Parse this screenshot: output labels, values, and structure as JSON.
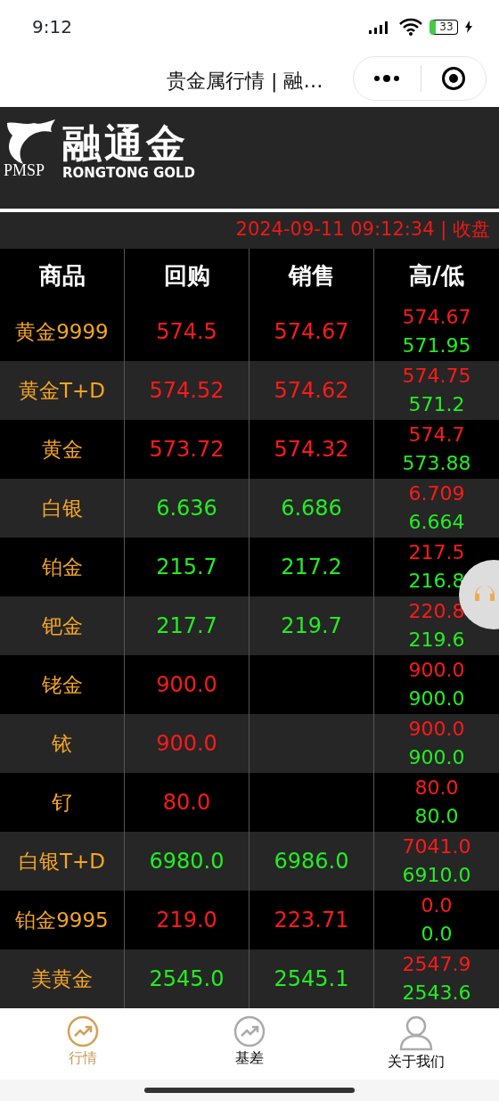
{
  "status_bar": {
    "time": "9:12",
    "battery": "33"
  },
  "title_bar": {
    "title": "贵金属行情 | 融…"
  },
  "header": {
    "logo_cn": "融通金",
    "logo_en": "RONGTONG GOLD",
    "logo_mark": "PMSP"
  },
  "timestamp": "2024-09-11 09:12:34 | 收盘",
  "table": {
    "columns": [
      "商品",
      "回购",
      "销售",
      "高/低"
    ],
    "rows": [
      {
        "name": "黄金9999",
        "buy": {
          "text": "574.5",
          "color": "#ff1a1a"
        },
        "sell": {
          "text": "574.67",
          "color": "#ff1a1a"
        },
        "high": {
          "text": "574.67",
          "color": "#ff1a1a"
        },
        "low": {
          "text": "571.95",
          "color": "#22ee22"
        }
      },
      {
        "name": "黄金T+D",
        "buy": {
          "text": "574.52",
          "color": "#ff1a1a"
        },
        "sell": {
          "text": "574.62",
          "color": "#ff1a1a"
        },
        "high": {
          "text": "574.75",
          "color": "#ff1a1a"
        },
        "low": {
          "text": "571.2",
          "color": "#22ee22"
        }
      },
      {
        "name": "黄金",
        "buy": {
          "text": "573.72",
          "color": "#ff1a1a"
        },
        "sell": {
          "text": "574.32",
          "color": "#ff1a1a"
        },
        "high": {
          "text": "574.7",
          "color": "#ff1a1a"
        },
        "low": {
          "text": "573.88",
          "color": "#22ee22"
        }
      },
      {
        "name": "白银",
        "buy": {
          "text": "6.636",
          "color": "#22ee22"
        },
        "sell": {
          "text": "6.686",
          "color": "#22ee22"
        },
        "high": {
          "text": "6.709",
          "color": "#ff1a1a"
        },
        "low": {
          "text": "6.664",
          "color": "#22ee22"
        }
      },
      {
        "name": "铂金",
        "buy": {
          "text": "215.7",
          "color": "#22ee22"
        },
        "sell": {
          "text": "217.2",
          "color": "#22ee22"
        },
        "high": {
          "text": "217.5",
          "color": "#ff1a1a"
        },
        "low": {
          "text": "216.8",
          "color": "#22ee22"
        }
      },
      {
        "name": "钯金",
        "buy": {
          "text": "217.7",
          "color": "#22ee22"
        },
        "sell": {
          "text": "219.7",
          "color": "#22ee22"
        },
        "high": {
          "text": "220.8",
          "color": "#ff1a1a"
        },
        "low": {
          "text": "219.6",
          "color": "#22ee22"
        }
      },
      {
        "name": "铑金",
        "buy": {
          "text": "900.0",
          "color": "#ff1a1a"
        },
        "high": {
          "text": "900.0",
          "color": "#ff1a1a"
        },
        "low": {
          "text": "900.0",
          "color": "#22ee22"
        }
      },
      {
        "name": "铱",
        "buy": {
          "text": "900.0",
          "color": "#ff1a1a"
        },
        "high": {
          "text": "900.0",
          "color": "#ff1a1a"
        },
        "low": {
          "text": "900.0",
          "color": "#22ee22"
        }
      },
      {
        "name": "钌",
        "buy": {
          "text": "80.0",
          "color": "#ff1a1a"
        },
        "high": {
          "text": "80.0",
          "color": "#ff1a1a"
        },
        "low": {
          "text": "80.0",
          "color": "#22ee22"
        }
      },
      {
        "name": "白银T+D",
        "buy": {
          "text": "6980.0",
          "color": "#22ee22"
        },
        "sell": {
          "text": "6986.0",
          "color": "#22ee22"
        },
        "high": {
          "text": "7041.0",
          "color": "#ff1a1a"
        },
        "low": {
          "text": "6910.0",
          "color": "#22ee22"
        }
      },
      {
        "name": "铂金9995",
        "buy": {
          "text": "219.0",
          "color": "#ff1a1a"
        },
        "sell": {
          "text": "223.71",
          "color": "#ff1a1a"
        },
        "high": {
          "text": "0.0",
          "color": "#ff1a1a"
        },
        "low": {
          "text": "0.0",
          "color": "#22ee22"
        }
      },
      {
        "name": "美黄金",
        "buy": {
          "text": "2545.0",
          "color": "#22ee22"
        },
        "sell": {
          "text": "2545.1",
          "color": "#22ee22"
        },
        "high": {
          "text": "2547.9",
          "color": "#ff1a1a"
        },
        "low": {
          "text": "2543.6",
          "color": "#22ee22"
        }
      }
    ]
  },
  "tab_bar": [
    {
      "label": "行情",
      "selected": true
    },
    {
      "label": "基差",
      "selected": false
    },
    {
      "label": "关于我们",
      "selected": false
    }
  ]
}
